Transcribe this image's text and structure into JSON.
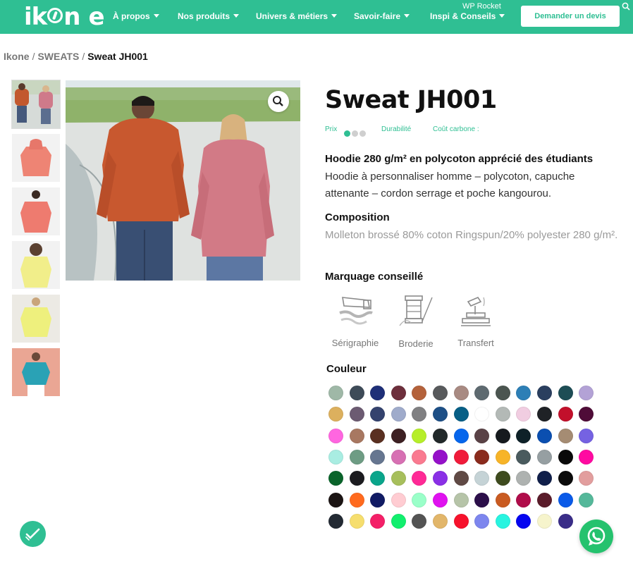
{
  "brand": {
    "logo_text": "ikone",
    "accent": "#2fbf93"
  },
  "header": {
    "nav": [
      {
        "label": "À propos"
      },
      {
        "label": "Nos produits"
      },
      {
        "label": "Univers & métiers"
      },
      {
        "label": "Savoir-faire"
      },
      {
        "label": "Inspi & Conseils"
      }
    ],
    "wp_rocket": "WP Rocket",
    "cta_label": "Demander un devis"
  },
  "breadcrumb": [
    "Ikone",
    "SWEATS",
    "Sweat JH001"
  ],
  "product": {
    "title": "Sweat JH001",
    "price_label": "Prix",
    "price_level": {
      "value": 1,
      "max": 3
    },
    "durability_label": "Durabilité",
    "carbon_label": "Coût carbone :",
    "subtitle": "Hoodie 280 g/m² en polycoton apprécié des étudiants",
    "description": "Hoodie à personnaliser homme – polycoton, capuche attenante – cordon serrage et poche kangourou.",
    "composition_heading": "Composition",
    "composition_text": "Molleton brossé 80% coton Ringspun/20% polyester 280 g/m².",
    "marking_heading": "Marquage conseillé",
    "marking": [
      {
        "label": "Sérigraphie",
        "icon": "screen-print-icon"
      },
      {
        "label": "Broderie",
        "icon": "embroidery-icon"
      },
      {
        "label": "Transfert",
        "icon": "heat-transfer-icon"
      }
    ],
    "color_heading": "Couleur",
    "colors": [
      "#9fb8a7",
      "#3e4b58",
      "#1e2f78",
      "#6d2f3c",
      "#b4623b",
      "#585a5c",
      "#a88a82",
      "#5e6a70",
      "#4b5550",
      "#2d7fb6",
      "#2a3f5f",
      "#1d4d55",
      "#b3a2d6",
      "#dcb05e",
      "#6c5b72",
      "#34426e",
      "#9fabcb",
      "#808082",
      "#1d4f86",
      "#075f86",
      "#ffffff",
      "#b3b9b6",
      "#f1cde1",
      "#1f2226",
      "#c2102b",
      "#4f0c38",
      "#ff66e0",
      "#a87861",
      "#5a3021",
      "#3d2023",
      "#b6ee2a",
      "#22292a",
      "#0666ec",
      "#5a4246",
      "#161a1e",
      "#0e2128",
      "#0b4fb0",
      "#a58c73",
      "#7562e2",
      "#a9ede2",
      "#6e9c84",
      "#667690",
      "#d770b3",
      "#fa7a90",
      "#9511c9",
      "#f01b3a",
      "#8a2b1d",
      "#f7b428",
      "#4a5b5e",
      "#969fa2",
      "#0a0a0a",
      "#ff0aa1",
      "#0a642b",
      "#1c1c20",
      "#0aa58b",
      "#a7bf5c",
      "#ff2a96",
      "#8a30e6",
      "#604a45",
      "#c5d3d6",
      "#3e4b1e",
      "#aeb2b0",
      "#101f4a",
      "#0b0b0b",
      "#e29e9e",
      "#1c1514",
      "#ff6a1e",
      "#111b64",
      "#ffccd2",
      "#9affc9",
      "#e012f0",
      "#b6c4a8",
      "#2c0f4a",
      "#c95b21",
      "#b00c4a",
      "#5a1c2a",
      "#0a5ae8",
      "#55b89a",
      "#232a33",
      "#f6de6e",
      "#f42068",
      "#12ef6e",
      "#545454",
      "#e2b66a",
      "#f7122c",
      "#7d86ee",
      "#28f4e0",
      "#0505f0",
      "#f6f4cc",
      "#3a2d88"
    ]
  },
  "icons": {
    "zoom": "magnifier-icon",
    "search": "search-icon",
    "whatsapp": "whatsapp-icon",
    "badge": "check-badge-icon"
  }
}
